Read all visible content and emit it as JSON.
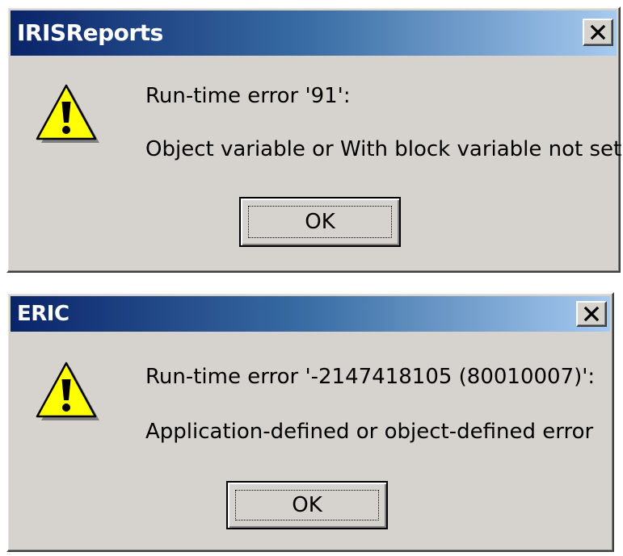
{
  "dialogs": [
    {
      "title": "IRISReports",
      "message_line1": "Run-time error '91':",
      "message_line2": "Object variable or With block variable not set",
      "ok_label": "OK",
      "close_icon": "close-icon",
      "icon": "warning-icon"
    },
    {
      "title": "ERIC",
      "message_line1": "Run-time error '-2147418105 (80010007)':",
      "message_line2": "Application-defined or object-defined error",
      "ok_label": "OK",
      "close_icon": "close-icon",
      "icon": "warning-icon"
    }
  ],
  "colors": {
    "titlebar_start": "#0a246a",
    "titlebar_end": "#a6caf0",
    "dialog_face": "#d6d3ce",
    "warning_fill": "#ffff00"
  }
}
